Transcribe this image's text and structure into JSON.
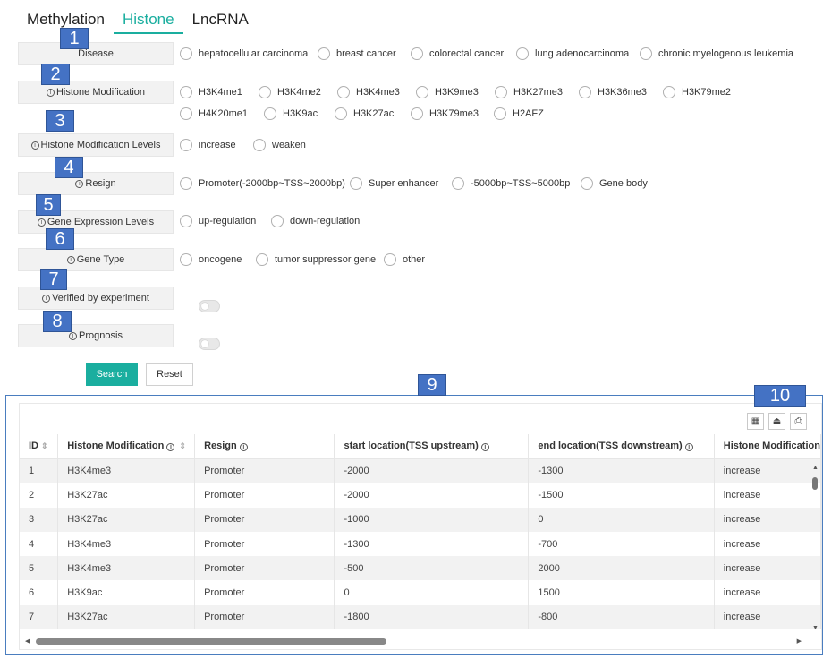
{
  "tabs": [
    "Methylation",
    "Histone",
    "LncRNA"
  ],
  "active_tab": "Histone",
  "filters": {
    "disease": {
      "label": "Disease",
      "options": [
        "hepatocellular carcinoma",
        "breast cancer",
        "colorectal cancer",
        "lung adenocarcinoma",
        "chronic myelogenous leukemia"
      ]
    },
    "histone_modification": {
      "label": "Histone Modification",
      "options_row1": [
        "H3K4me1",
        "H3K4me2",
        "H3K4me3",
        "H3K9me3",
        "H3K27me3",
        "H3K36me3",
        "H3K79me2"
      ],
      "options_row2": [
        "H4K20me1",
        "H3K9ac",
        "H3K27ac",
        "H3K79me3",
        "H2AFZ"
      ]
    },
    "histone_modification_levels": {
      "label": "Histone Modification Levels",
      "options": [
        "increase",
        "weaken"
      ]
    },
    "resign": {
      "label": "Resign",
      "options": [
        "Promoter(-2000bp~TSS~2000bp)",
        "Super enhancer",
        "-5000bp~TSS~5000bp",
        "Gene body"
      ]
    },
    "gene_expression_levels": {
      "label": "Gene Expression Levels",
      "options": [
        "up-regulation",
        "down-regulation"
      ]
    },
    "gene_type": {
      "label": "Gene Type",
      "options": [
        "oncogene",
        "tumor suppressor gene",
        "other"
      ]
    },
    "verified": {
      "label": "Verified by experiment"
    },
    "prognosis": {
      "label": "Prognosis"
    }
  },
  "buttons": {
    "search": "Search",
    "reset": "Reset"
  },
  "annotations": [
    "1",
    "2",
    "3",
    "4",
    "5",
    "6",
    "7",
    "8",
    "9",
    "10"
  ],
  "table": {
    "columns": [
      "ID",
      "Histone Modification",
      "Resign",
      "start location(TSS upstream)",
      "end location(TSS downstream)",
      "Histone Modification"
    ],
    "rows": [
      [
        "1",
        "H3K4me3",
        "Promoter",
        "-2000",
        "-1300",
        "increase"
      ],
      [
        "2",
        "H3K27ac",
        "Promoter",
        "-2000",
        "-1500",
        "increase"
      ],
      [
        "3",
        "H3K27ac",
        "Promoter",
        "-1000",
        "0",
        "increase"
      ],
      [
        "4",
        "H3K4me3",
        "Promoter",
        "-1300",
        "-700",
        "increase"
      ],
      [
        "5",
        "H3K4me3",
        "Promoter",
        "-500",
        "2000",
        "increase"
      ],
      [
        "6",
        "H3K9ac",
        "Promoter",
        "0",
        "1500",
        "increase"
      ],
      [
        "7",
        "H3K27ac",
        "Promoter",
        "-1800",
        "-800",
        "increase"
      ]
    ]
  },
  "toolbar_icons": [
    "columns-icon",
    "export-icon",
    "print-icon"
  ],
  "colors": {
    "accent": "#1aae9f",
    "annotation": "#4472c4"
  }
}
